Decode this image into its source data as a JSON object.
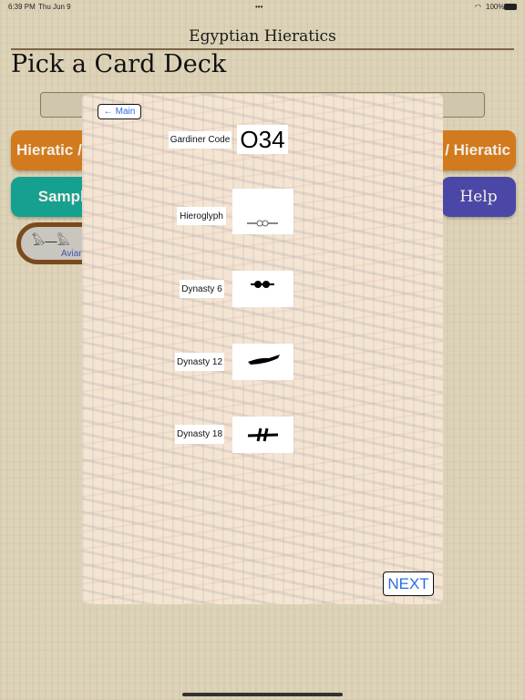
{
  "status": {
    "time": "6:39 PM",
    "date": "Thu Jun 9",
    "battery": "100%"
  },
  "app_title": "Egyptian Hieratics",
  "heading": "Pick a Card Deck",
  "buttons": {
    "hieratic_left": "Hieratic /",
    "hieratic_right": "/ Hieratic",
    "sample": "Sample",
    "help": "Help"
  },
  "deck": {
    "label": "Avian"
  },
  "modal": {
    "back_label": "Main",
    "gardiner_label": "Gardiner Code",
    "gardiner_code": "O34",
    "rows": [
      {
        "label": "Hieroglyph"
      },
      {
        "label": "Dynasty 6"
      },
      {
        "label": "Dynasty 12"
      },
      {
        "label": "Dynasty 18"
      }
    ],
    "next_label": "NEXT"
  },
  "colors": {
    "orange": "#d17a1e",
    "teal": "#16a090",
    "purple": "#4b47a6",
    "link": "#2a6fe0"
  }
}
